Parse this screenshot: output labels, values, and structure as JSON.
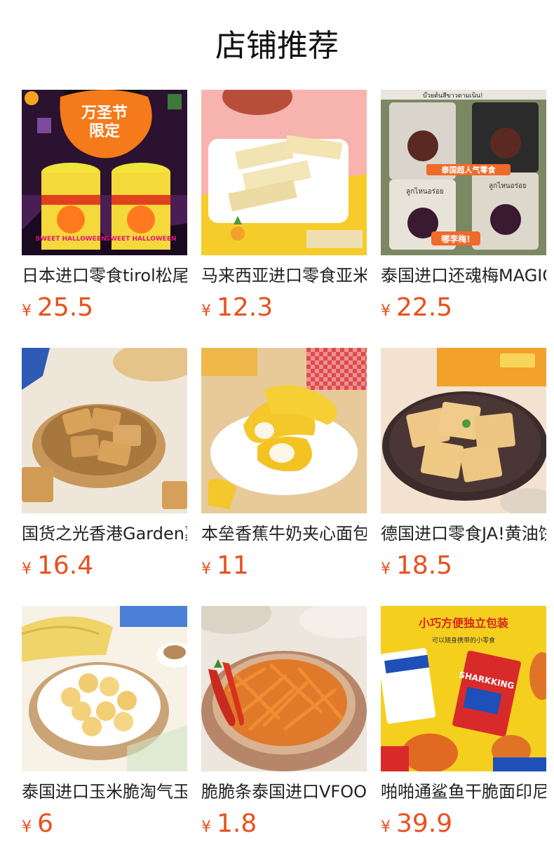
{
  "header": {
    "title": "店铺推荐"
  },
  "colors": {
    "price": "#e8501e",
    "text": "#222222"
  },
  "products": [
    {
      "name": "日本进口零食tirol松尾巧克力",
      "currency": "¥",
      "price": "25.5",
      "banner_line1": "万圣节",
      "banner_line2": "限定",
      "label": "SWEET HALLOWEEN"
    },
    {
      "name": "马来西亚进口零食亚米威化饼干",
      "currency": "¥",
      "price": "12.3"
    },
    {
      "name": "泰国进口还魂梅MAGIC话梅",
      "currency": "¥",
      "price": "22.5",
      "banner": "泰国超人气零食",
      "tag": "哪李梅!",
      "thai_top": "บ๊วยต้นสีขาวตามเนิน!",
      "thai_pack": "ลูกไหนอร่อย"
    },
    {
      "name": "国货之光香港Garden嘉顿饼干",
      "currency": "¥",
      "price": "16.4"
    },
    {
      "name": "本垒香蕉牛奶夹心面包",
      "currency": "¥",
      "price": "11"
    },
    {
      "name": "德国进口零食JA!黄油饼干",
      "currency": "¥",
      "price": "18.5"
    },
    {
      "name": "泰国进口玉米脆淘气玉米粒",
      "currency": "¥",
      "price": "6"
    },
    {
      "name": "脆脆条泰国进口VFOODS薯条",
      "currency": "¥",
      "price": "1.8"
    },
    {
      "name": "啪啪通鲨鱼干脆面印尼进口",
      "currency": "¥",
      "price": "39.9",
      "headline": "小巧方便独立包装",
      "subline": "可以随身携带的小零食",
      "brand": "SHARKKING"
    }
  ]
}
